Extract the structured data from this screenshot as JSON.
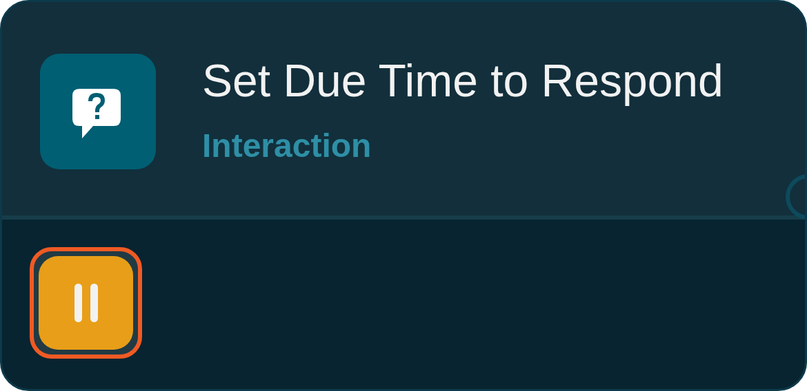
{
  "node": {
    "title": "Set Due Time to Respond",
    "category": "Interaction"
  },
  "pause_button": {
    "selected": true
  }
}
